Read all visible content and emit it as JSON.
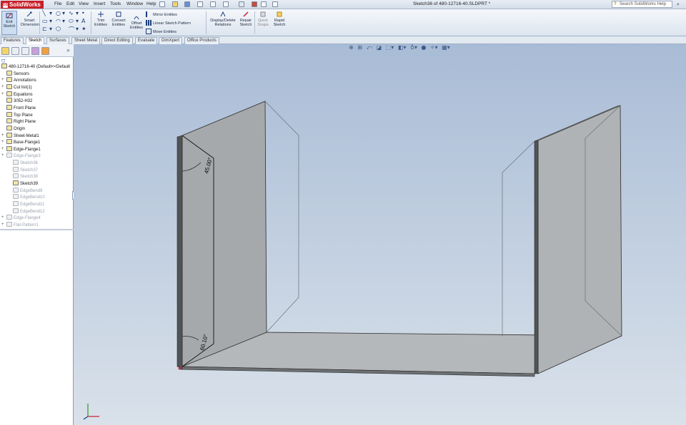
{
  "app": {
    "logo_text": "SolidWorks",
    "document_title": "Sketch36 of 480-12716-40.SLDPRT *",
    "help_search_placeholder": "Search SolidWorks Help"
  },
  "menu": [
    "File",
    "Edit",
    "View",
    "Insert",
    "Tools",
    "Window",
    "Help"
  ],
  "command_manager": {
    "exit_sketch": "Exit\nSketch",
    "smart_dimension": "Smart\nDimension",
    "trim_entities": "Trim\nEntities",
    "convert_entities": "Convert\nEntities",
    "offset_entities": "Offset\nEntities",
    "mirror_entities": "Mirror Entities",
    "linear_sketch_pattern": "Linear Sketch Pattern",
    "move_entities": "Move Entities",
    "display_delete_relations": "Display/Delete\nRelations",
    "repair_sketch": "Repair\nSketch",
    "quick_snaps": "Quick\nSnaps",
    "rapid_sketch": "Rapid\nSketch"
  },
  "tabs": [
    {
      "label": "Features",
      "active": false
    },
    {
      "label": "Sketch",
      "active": true
    },
    {
      "label": "Surfaces",
      "active": false
    },
    {
      "label": "Sheet Metal",
      "active": false
    },
    {
      "label": "Direct Editing",
      "active": false
    },
    {
      "label": "Evaluate",
      "active": false
    },
    {
      "label": "DimXpert",
      "active": false
    },
    {
      "label": "Office Products",
      "active": false
    }
  ],
  "feature_tree": [
    {
      "label": "480-12716-40  (Default<<Default",
      "dim": false
    },
    {
      "label": "Sensors",
      "dim": false
    },
    {
      "label": "Annotations",
      "dim": false
    },
    {
      "label": "Cut list(1)",
      "dim": false
    },
    {
      "label": "Equations",
      "dim": false
    },
    {
      "label": "3052-H32",
      "dim": false
    },
    {
      "label": "Front Plane",
      "dim": false
    },
    {
      "label": "Top Plane",
      "dim": false
    },
    {
      "label": "Right Plane",
      "dim": false
    },
    {
      "label": "Origin",
      "dim": false
    },
    {
      "label": "Sheet-Metal1",
      "dim": false
    },
    {
      "label": "Base-Flange1",
      "dim": false
    },
    {
      "label": "Edge-Flange1",
      "dim": false
    },
    {
      "label": "Edge-Flange3",
      "dim": true
    },
    {
      "label": "Sketch36",
      "dim": true
    },
    {
      "label": "Sketch37",
      "dim": true
    },
    {
      "label": "Sketch38",
      "dim": true
    },
    {
      "label": "Sketch39",
      "dim": false
    },
    {
      "label": "EdgeBend9",
      "dim": true
    },
    {
      "label": "EdgeBend10",
      "dim": true
    },
    {
      "label": "EdgeBend11",
      "dim": true
    },
    {
      "label": "EdgeBend12",
      "dim": true
    },
    {
      "label": "Edge-Flange4",
      "dim": true
    },
    {
      "label": "Flat-Pattern1",
      "dim": true
    }
  ],
  "dimensions": {
    "angle_top": "45.00°",
    "angle_bottom": "60.10°"
  },
  "colors": {
    "viewport_top": "#a9bcd6",
    "viewport_bottom": "#d9e1ea",
    "part_face": "#b3b6b8",
    "part_edge": "#2a2a2a"
  }
}
